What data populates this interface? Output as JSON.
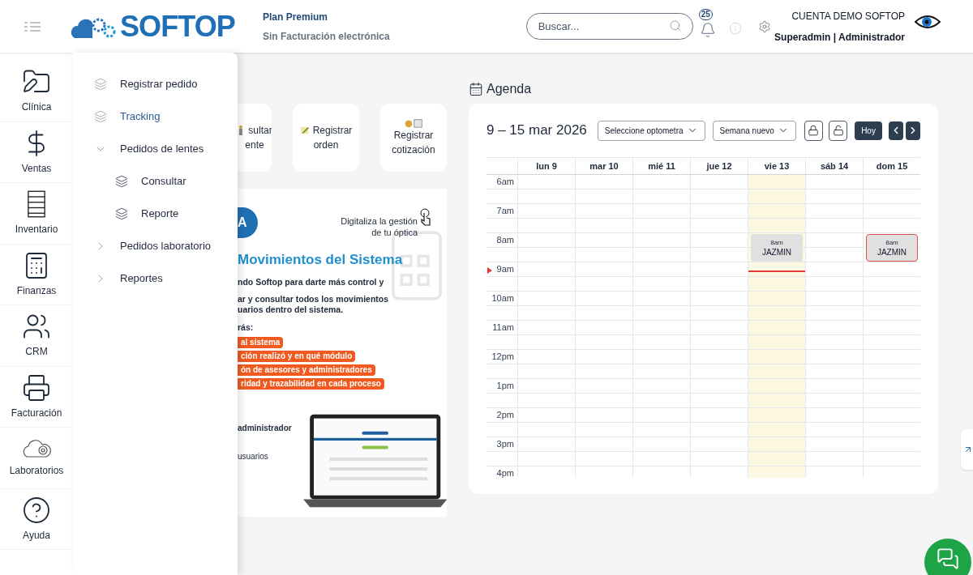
{
  "header": {
    "logo": "SOFTOP",
    "plan": "Plan Premium",
    "billing": "Sin Facturación electrónica",
    "search": {
      "placeholder": "Buscar..."
    },
    "notifications": "25",
    "account": "CUENTA DEMO SOFTOP",
    "role": "Superadmin | Administrador"
  },
  "sidebar": {
    "items": [
      {
        "label": "Clínica",
        "kind": "folder",
        "selected": false
      },
      {
        "label": "Ventas",
        "kind": "dollar",
        "selected": false
      },
      {
        "label": "Inventario",
        "kind": "cabinet",
        "selected": false
      },
      {
        "label": "Finanzas",
        "kind": "calculator",
        "selected": false
      },
      {
        "label": "CRM",
        "kind": "people",
        "selected": false
      },
      {
        "label": "Facturación",
        "kind": "printer",
        "selected": false
      },
      {
        "label": "Laboratorios",
        "kind": "lab",
        "selected": false
      },
      {
        "label": "Ayuda",
        "kind": "help",
        "selected": false
      }
    ]
  },
  "submenu": [
    {
      "label": "Registrar pedido",
      "kind": "link",
      "selected": false
    },
    {
      "label": "Tracking",
      "kind": "link",
      "selected": true
    },
    {
      "label": "Pedidos de lentes",
      "kind": "group",
      "expanded": true,
      "children": [
        {
          "label": "Consultar",
          "kind": "link",
          "selected": false
        },
        {
          "label": "Reporte",
          "kind": "link",
          "selected": false
        }
      ]
    },
    {
      "label": "Pedidos laboratorio",
      "kind": "group",
      "expanded": false
    },
    {
      "label": "Reportes",
      "kind": "group",
      "expanded": false
    }
  ],
  "quick_actions": [
    {
      "lines": [
        "sultar",
        "ente"
      ],
      "kind": "person"
    },
    {
      "lines": [
        "Registrar",
        "orden"
      ],
      "kind": "note"
    },
    {
      "lines": [
        "Registrar",
        "cotización"
      ],
      "kind": "money"
    }
  ],
  "banner": {
    "badge": "A",
    "tagline": [
      "Digitaliza la gestión",
      "de tu óptica"
    ],
    "title": "Movimientos del Sistema",
    "paragraphs": [
      "ndo Softop para darte más control y",
      "ar y consultar todos los movimientos\nuarios dentro del sistema."
    ],
    "lead": "rás:",
    "bullets": [
      "al sistema",
      "ción realizó y en qué módulo",
      "ón de asesores y administradores",
      "ridad y trazabilidad en cada proceso"
    ],
    "roles": [
      "administrador",
      "usuarios"
    ]
  },
  "agenda": {
    "title": "Agenda",
    "range": "9 – 15 mar 2026",
    "optometrist_select": "Seleccione optometra",
    "view_select": "Semana nuevo",
    "today_button": "Hoy",
    "days": [
      {
        "label": "lun 9",
        "today": false
      },
      {
        "label": "mar 10",
        "today": false
      },
      {
        "label": "mié 11",
        "today": false
      },
      {
        "label": "jue 12",
        "today": false
      },
      {
        "label": "vie 13",
        "today": true,
        "events": [
          {
            "time": "8am",
            "name": "JAZMIN",
            "outlined": false
          }
        ]
      },
      {
        "label": "sáb 14",
        "today": false
      },
      {
        "label": "dom 15",
        "today": false,
        "events": [
          {
            "time": "8am",
            "name": "JAZMIN",
            "outlined": true
          }
        ]
      }
    ],
    "hours": [
      {
        "label": "6am"
      },
      {
        "label": "7am"
      },
      {
        "label": "8am"
      },
      {
        "label": "9am",
        "now": true
      },
      {
        "label": "10am"
      },
      {
        "label": "11am"
      },
      {
        "label": "12pm"
      },
      {
        "label": "1pm"
      },
      {
        "label": "2pm"
      },
      {
        "label": "3pm"
      },
      {
        "label": "4pm"
      }
    ]
  }
}
